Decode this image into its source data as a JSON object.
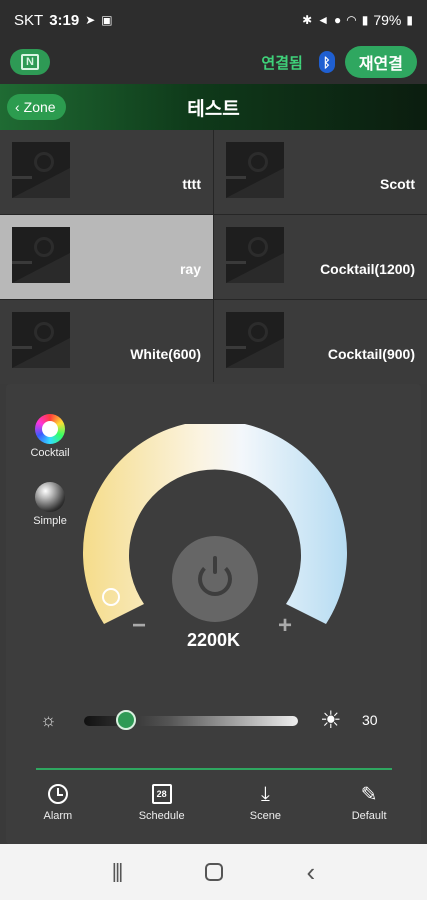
{
  "status_bar": {
    "carrier": "SKT",
    "time": "3:19",
    "battery": "79%"
  },
  "app_bar": {
    "logo_icon": "app-logo-icon",
    "connection_status": "연결됨",
    "bluetooth_icon": "bluetooth-icon",
    "reconnect_label": "재연결"
  },
  "title_bar": {
    "back_label": "Zone",
    "title": "테스트"
  },
  "scenes": [
    {
      "name": "tttt",
      "selected": false
    },
    {
      "name": "Scott",
      "selected": false
    },
    {
      "name": "ray",
      "selected": true
    },
    {
      "name": "Cocktail(1200)",
      "selected": false
    },
    {
      "name": "White(600)",
      "selected": false
    },
    {
      "name": "Cocktail(900)",
      "selected": false
    }
  ],
  "modes": {
    "cocktail_label": "Cocktail",
    "simple_label": "Simple"
  },
  "dial": {
    "color_temperature": "2200K",
    "minus": "−",
    "plus": "+",
    "level": 0.0
  },
  "brightness": {
    "value": "30",
    "level": 0.3
  },
  "tabs": [
    {
      "label": "Alarm",
      "icon": "clock-icon"
    },
    {
      "label": "Schedule",
      "icon": "calendar-icon"
    },
    {
      "label": "Scene",
      "icon": "download-icon"
    },
    {
      "label": "Default",
      "icon": "edit-icon"
    }
  ],
  "calendar_day": "28",
  "colors": {
    "accent": "#2fa760",
    "connected": "#3fd27a",
    "selected_scene": "#b8b8b8"
  }
}
